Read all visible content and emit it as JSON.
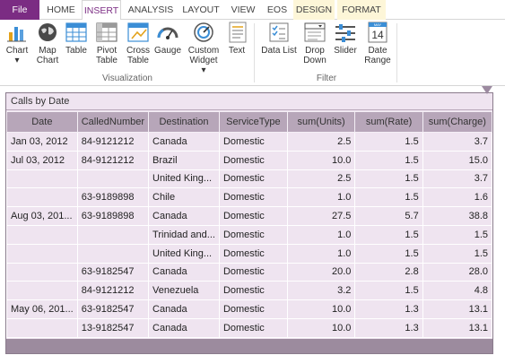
{
  "tabs": [
    "File",
    "HOME",
    "INSERT",
    "ANALYSIS",
    "LAYOUT",
    "VIEW",
    "EOS",
    "DESIGN",
    "FORMAT"
  ],
  "ribbon": {
    "visualization_buttons": [
      {
        "label": "Chart",
        "arrow": "▾"
      },
      {
        "label": "Map Chart"
      },
      {
        "label": "Table"
      },
      {
        "label": "Pivot Table"
      },
      {
        "label": "Cross Table"
      },
      {
        "label": "Gauge"
      },
      {
        "label": "Custom Widget",
        "arrow": "▾"
      },
      {
        "label": "Text"
      }
    ],
    "filter_buttons": [
      {
        "label": "Data List"
      },
      {
        "label": "Drop Down"
      },
      {
        "label": "Slider"
      },
      {
        "label": "Date Range"
      }
    ],
    "group_visualization": "Visualization",
    "group_filter": "Filter",
    "calendar_month": "MAY",
    "calendar_day": "14"
  },
  "grid": {
    "title": "Calls by Date",
    "columns": [
      "Date",
      "CalledNumber",
      "Destination",
      "ServiceType",
      "sum(Units)",
      "sum(Rate)",
      "sum(Charge)"
    ],
    "rows": [
      [
        "Jan 03, 2012",
        "84-9121212",
        "Canada",
        "Domestic",
        "2.5",
        "1.5",
        "3.7"
      ],
      [
        "Jul 03, 2012",
        "84-9121212",
        "Brazil",
        "Domestic",
        "10.0",
        "1.5",
        "15.0"
      ],
      [
        "",
        "",
        "United King...",
        "Domestic",
        "2.5",
        "1.5",
        "3.7"
      ],
      [
        "",
        "63-9189898",
        "Chile",
        "Domestic",
        "1.0",
        "1.5",
        "1.6"
      ],
      [
        "Aug 03, 201...",
        "63-9189898",
        "Canada",
        "Domestic",
        "27.5",
        "5.7",
        "38.8"
      ],
      [
        "",
        "",
        "Trinidad and...",
        "Domestic",
        "1.0",
        "1.5",
        "1.5"
      ],
      [
        "",
        "",
        "United King...",
        "Domestic",
        "1.0",
        "1.5",
        "1.5"
      ],
      [
        "",
        "63-9182547",
        "Canada",
        "Domestic",
        "20.0",
        "2.8",
        "28.0"
      ],
      [
        "",
        "84-9121212",
        "Venezuela",
        "Domestic",
        "3.2",
        "1.5",
        "4.8"
      ],
      [
        "May 06, 201...",
        "63-9182547",
        "Canada",
        "Domestic",
        "10.0",
        "1.3",
        "13.1"
      ],
      [
        "",
        "13-9182547",
        "Canada",
        "Domestic",
        "10.0",
        "1.3",
        "13.1"
      ]
    ]
  },
  "colors": {
    "accent": "#7b2c83",
    "header": "#b7a6b9",
    "cell": "#efe4f0",
    "footer": "#9c8b9e"
  }
}
